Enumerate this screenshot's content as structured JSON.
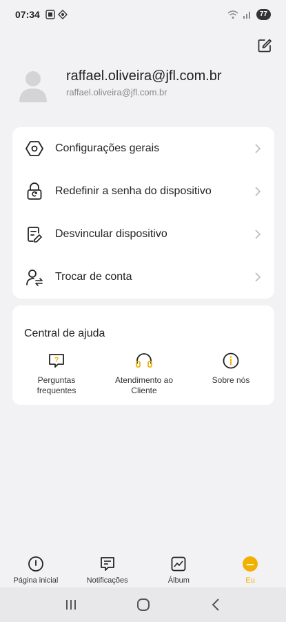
{
  "status_bar": {
    "time": "07:34",
    "battery": "77"
  },
  "profile": {
    "name": "raffael.oliveira@jfl.com.br",
    "email": "raffael.oliveira@jfl.com.br"
  },
  "menu": {
    "items": [
      {
        "label": "Configurações gerais",
        "icon": "hexagon-settings-icon"
      },
      {
        "label": "Redefinir a senha do dispositivo",
        "icon": "lock-reset-icon"
      },
      {
        "label": "Desvincular dispositivo",
        "icon": "unlink-document-icon"
      },
      {
        "label": "Trocar de conta",
        "icon": "switch-account-icon"
      }
    ]
  },
  "help": {
    "title": "Central de ajuda",
    "items": [
      {
        "label": "Perguntas frequentes",
        "icon": "faq-icon"
      },
      {
        "label": "Atendimento ao Cliente",
        "icon": "headset-icon"
      },
      {
        "label": "Sobre nós",
        "icon": "info-icon"
      }
    ]
  },
  "bottom_nav": {
    "items": [
      {
        "label": "Página inicial",
        "icon": "home-icon"
      },
      {
        "label": "Notificações",
        "icon": "message-icon"
      },
      {
        "label": "Álbum",
        "icon": "album-icon"
      },
      {
        "label": "Eu",
        "icon": "profile-icon",
        "active": true
      }
    ]
  },
  "colors": {
    "accent": "#f0b100",
    "background": "#f2f2f4",
    "card": "#ffffff"
  }
}
